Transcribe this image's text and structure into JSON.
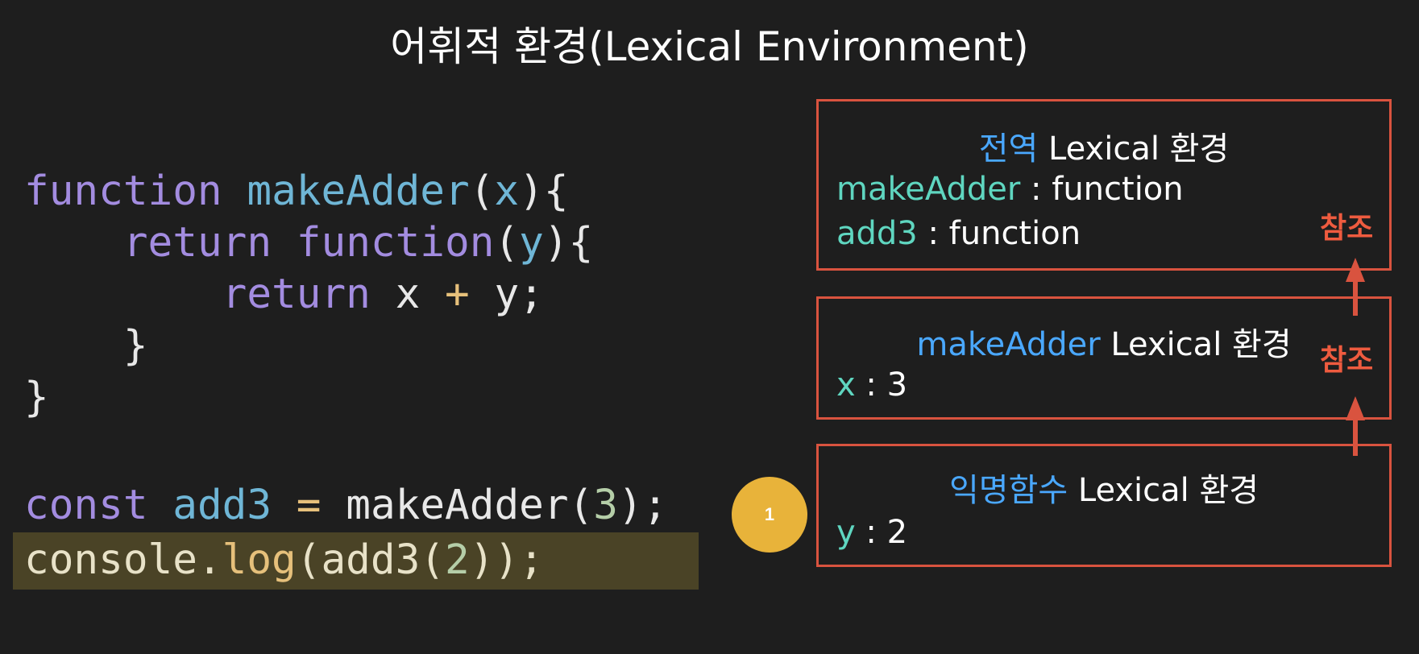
{
  "title": "어휘적 환경(Lexical Environment)",
  "code": {
    "line1": {
      "kw": "function",
      "name": "makeAdder",
      "open": "(",
      "param": "x",
      "close": "){"
    },
    "line2": {
      "kw1": "return",
      "kw2": "function",
      "open": "(",
      "param": "y",
      "close": "){"
    },
    "line3": {
      "kw": "return",
      "a": "x",
      "op": "+",
      "b": "y;"
    },
    "line4": "}",
    "line5": "}",
    "line6": {
      "kw": "const",
      "name": "add3",
      "eq": "=",
      "call": "makeAdder(",
      "num": "3",
      "end": ");"
    },
    "line7": {
      "obj": "console.",
      "meth": "log",
      "open": "(add3(",
      "num": "2",
      "end": "));"
    }
  },
  "boxes": {
    "global": {
      "title_hl": "전역",
      "title_rest": " Lexical 환경",
      "vars": [
        {
          "name": "makeAdder",
          "sep": " : ",
          "value": "function"
        },
        {
          "name": "add3",
          "sep": " : ",
          "value": "function"
        }
      ]
    },
    "make_adder": {
      "title_hl": "makeAdder",
      "title_rest": " Lexical 환경",
      "vars": [
        {
          "name": "x",
          "sep": " : ",
          "value": "3"
        }
      ]
    },
    "anonymous": {
      "title_hl": "익명함수",
      "title_rest": " Lexical 환경",
      "vars": [
        {
          "name": "y",
          "sep": " : ",
          "value": "2"
        }
      ]
    }
  },
  "ref_labels": [
    "참조",
    "참조"
  ],
  "badge": "1",
  "colors": {
    "background": "#1e1e1e",
    "box_border": "#d9533f",
    "arrow": "#d9533f",
    "title_highlight": "#4aa8ff",
    "var_name": "#5fd6c0",
    "badge": "#e8b33a",
    "line_highlight": "#4a4326"
  }
}
